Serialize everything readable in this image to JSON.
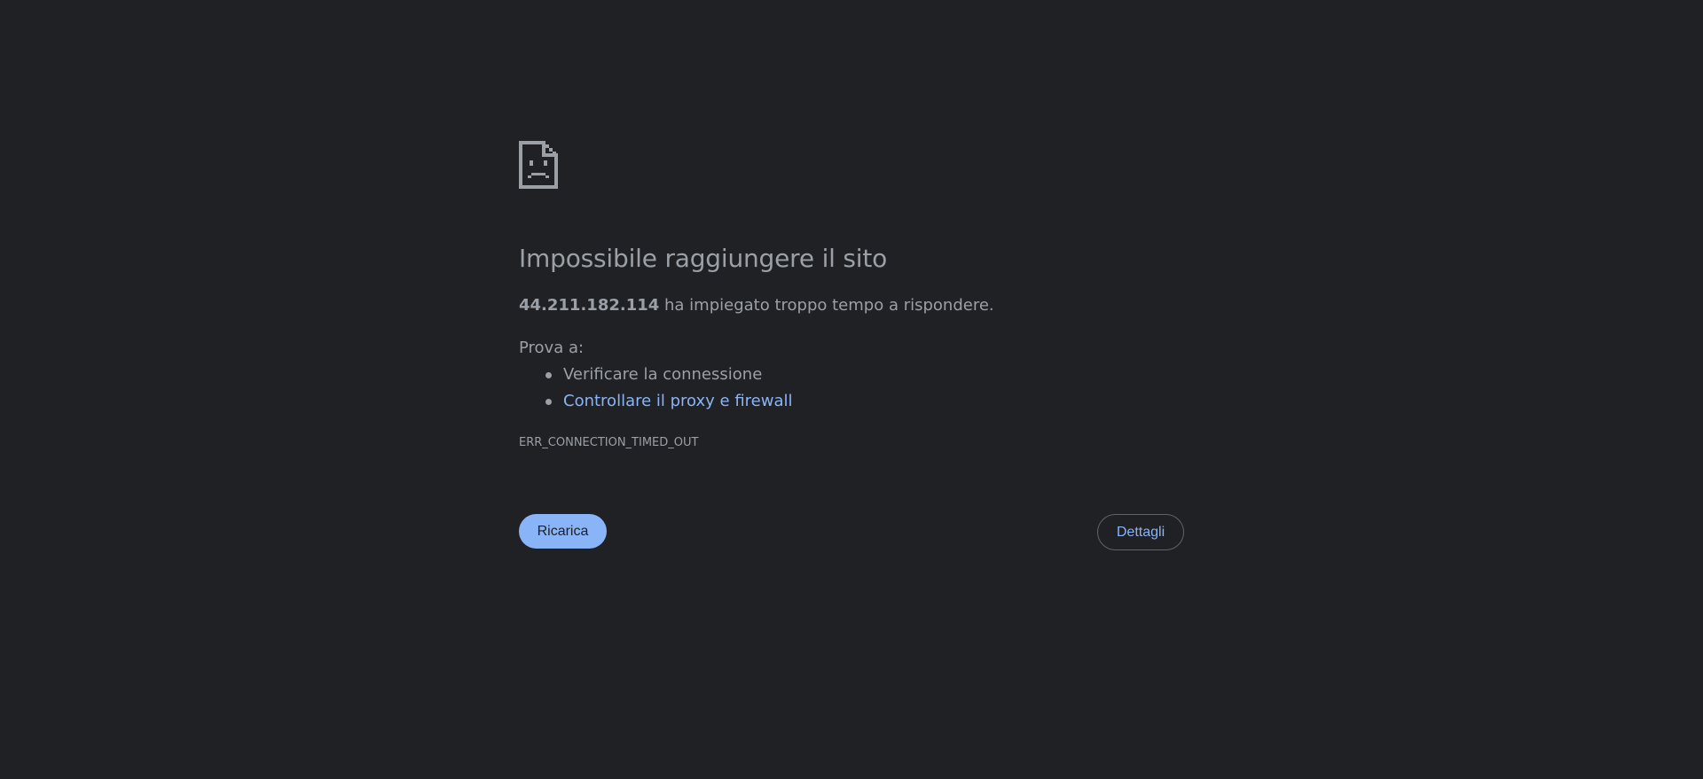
{
  "error": {
    "icon": "sad-document-icon",
    "title": "Impossibile raggiungere il sito",
    "host": "44.211.182.114",
    "description_suffix": " ha impiegato troppo tempo a rispondere.",
    "suggestions_intro": "Prova a:",
    "suggestions": [
      {
        "label": "Verificare la connessione",
        "is_link": false
      },
      {
        "label": "Controllare il proxy e firewall",
        "is_link": true
      }
    ],
    "code": "ERR_CONNECTION_TIMED_OUT"
  },
  "buttons": {
    "reload_label": "Ricarica",
    "details_label": "Dettagli"
  },
  "colors": {
    "background": "#202124",
    "text": "#9aa0a6",
    "link": "#8ab4f8",
    "primary_button": "#8ab4f8",
    "outline": "#5f6368"
  }
}
